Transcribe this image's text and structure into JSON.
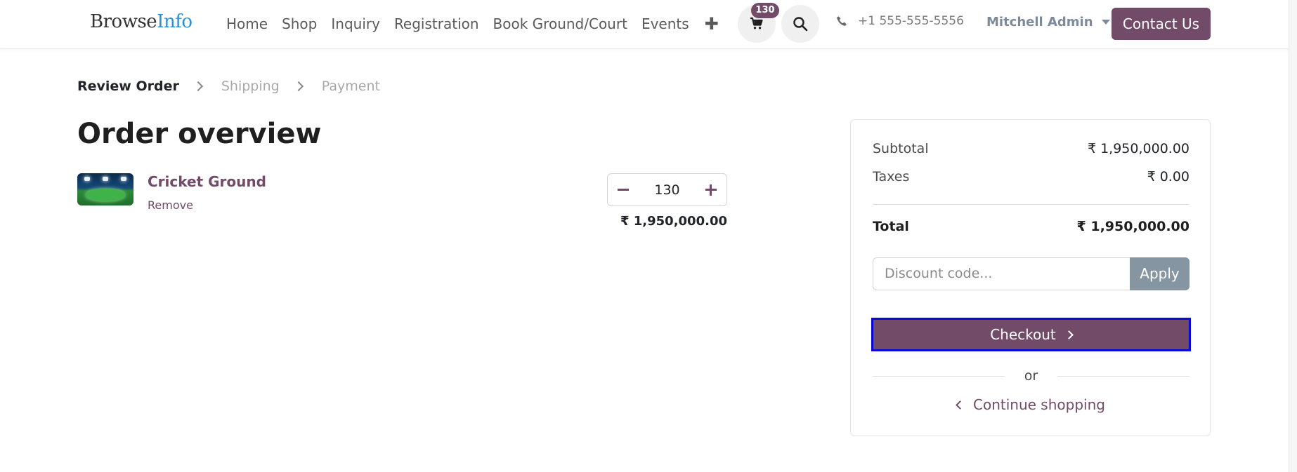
{
  "header": {
    "logo_main": "Browse",
    "logo_accent": "Info",
    "nav": [
      "Home",
      "Shop",
      "Inquiry",
      "Registration",
      "Book Ground/Court",
      "Events"
    ],
    "cart_count": "130",
    "phone": "+1 555-555-5556",
    "user": "Mitchell Admin",
    "contact_label": "Contact Us"
  },
  "steps": {
    "review": "Review Order",
    "shipping": "Shipping",
    "payment": "Payment"
  },
  "page_title": "Order overview",
  "item": {
    "name": "Cricket Ground",
    "remove_label": "Remove",
    "quantity": "130",
    "price": "₹ 1,950,000.00"
  },
  "summary": {
    "subtotal_label": "Subtotal",
    "subtotal_value": "₹ 1,950,000.00",
    "taxes_label": "Taxes",
    "taxes_value": "₹ 0.00",
    "total_label": "Total",
    "total_value": "₹ 1,950,000.00",
    "discount_placeholder": "Discount code...",
    "apply_label": "Apply",
    "checkout_label": "Checkout",
    "or_label": "or",
    "continue_label": "Continue shopping"
  },
  "colors": {
    "brand": "#714b67",
    "apply_button": "#8595a2",
    "focus_outline": "#0a0ad8"
  }
}
